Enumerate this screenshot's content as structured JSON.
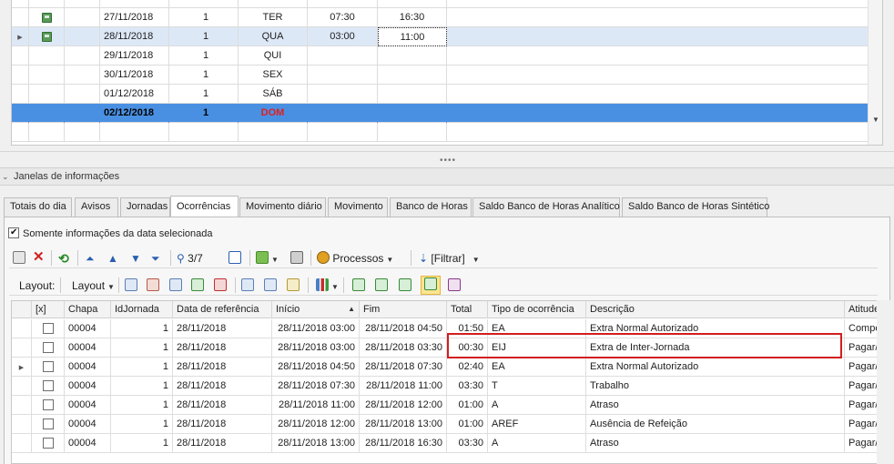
{
  "top_grid": {
    "rows": [
      {
        "icon": "calendar-check-icon",
        "date": "27/11/2018",
        "jornada": "1",
        "day": "TER",
        "start": "07:30",
        "end": "16:30",
        "state": "normal"
      },
      {
        "icon": "calendar-check-icon",
        "date": "28/11/2018",
        "jornada": "1",
        "day": "QUA",
        "start": "03:00",
        "end": "11:00",
        "state": "current"
      },
      {
        "icon": "",
        "date": "29/11/2018",
        "jornada": "1",
        "day": "QUI",
        "start": "",
        "end": "",
        "state": "normal"
      },
      {
        "icon": "",
        "date": "30/11/2018",
        "jornada": "1",
        "day": "SEX",
        "start": "",
        "end": "",
        "state": "normal"
      },
      {
        "icon": "",
        "date": "01/12/2018",
        "jornada": "1",
        "day": "SÁB",
        "start": "",
        "end": "",
        "state": "normal"
      },
      {
        "icon": "",
        "date": "02/12/2018",
        "jornada": "1",
        "day": "DOM",
        "start": "",
        "end": "",
        "state": "selected"
      }
    ]
  },
  "info_panel": {
    "title": "Janelas de informações"
  },
  "tabs": [
    {
      "label": "Totais do dia"
    },
    {
      "label": "Avisos"
    },
    {
      "label": "Jornadas"
    },
    {
      "label": "Ocorrências"
    },
    {
      "label": "Movimento diário"
    },
    {
      "label": "Movimento"
    },
    {
      "label": "Banco de Horas"
    },
    {
      "label": "Saldo Banco de Horas Analítico"
    },
    {
      "label": "Saldo Banco de Horas Sintético"
    }
  ],
  "active_tab": "Ocorrências",
  "filter": {
    "label": "Somente informações da data selecionada",
    "checked": true
  },
  "toolbar1": {
    "record_counter": "3/7",
    "processes_label": "Processos",
    "filter_label": "[Filtrar]"
  },
  "toolbar2": {
    "layout_label": "Layout:",
    "layout_dropdown": "Layout"
  },
  "grid": {
    "columns": [
      "[x]",
      "Chapa",
      "IdJornada",
      "Data de referência",
      "Início",
      "Fim",
      "Total",
      "Tipo de ocorrência",
      "Descrição",
      "Atitude"
    ],
    "sorted_column": "Início",
    "rows": [
      {
        "chapa": "00004",
        "idjornada": "1",
        "data": "28/11/2018",
        "inicio": "28/11/2018 03:00",
        "fim": "28/11/2018 04:50",
        "total": "01:50",
        "tipo": "EA",
        "descricao": "Extra Normal Autorizado",
        "atitude": "Compe"
      },
      {
        "chapa": "00004",
        "idjornada": "1",
        "data": "28/11/2018",
        "inicio": "28/11/2018 03:00",
        "fim": "28/11/2018 03:30",
        "total": "00:30",
        "tipo": "EIJ",
        "descricao": "Extra de Inter-Jornada",
        "atitude": "Pagar/"
      },
      {
        "chapa": "00004",
        "idjornada": "1",
        "data": "28/11/2018",
        "inicio": "28/11/2018 04:50",
        "fim": "28/11/2018 07:30",
        "total": "02:40",
        "tipo": "EA",
        "descricao": "Extra Normal Autorizado",
        "atitude": "Pagar/"
      },
      {
        "chapa": "00004",
        "idjornada": "1",
        "data": "28/11/2018",
        "inicio": "28/11/2018 07:30",
        "fim": "28/11/2018 11:00",
        "total": "03:30",
        "tipo": "T",
        "descricao": "Trabalho",
        "atitude": "Pagar/"
      },
      {
        "chapa": "00004",
        "idjornada": "1",
        "data": "28/11/2018",
        "inicio": "28/11/2018 11:00",
        "fim": "28/11/2018 12:00",
        "total": "01:00",
        "tipo": "A",
        "descricao": "Atraso",
        "atitude": "Pagar/"
      },
      {
        "chapa": "00004",
        "idjornada": "1",
        "data": "28/11/2018",
        "inicio": "28/11/2018 12:00",
        "fim": "28/11/2018 13:00",
        "total": "01:00",
        "tipo": "AREF",
        "descricao": "Ausência de Refeição",
        "atitude": "Pagar/"
      },
      {
        "chapa": "00004",
        "idjornada": "1",
        "data": "28/11/2018",
        "inicio": "28/11/2018 13:00",
        "fim": "28/11/2018 16:30",
        "total": "03:30",
        "tipo": "A",
        "descricao": "Atraso",
        "atitude": "Pagar/"
      }
    ]
  },
  "colors": {
    "selection": "#4a90e2",
    "highlight_box": "#d21e1e",
    "weekend_red": "#e02020"
  }
}
